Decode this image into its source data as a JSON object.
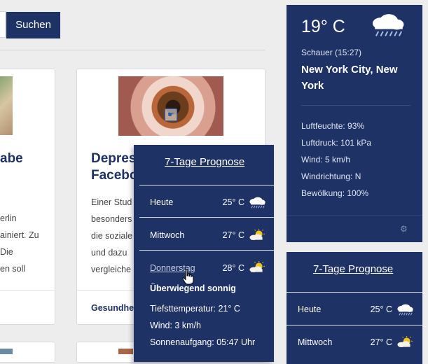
{
  "search": {
    "button_label": "Suchen"
  },
  "articles": [
    {
      "title": "abe",
      "excerpt": [
        "erlin",
        "ainiert. Zu",
        " Die",
        "en soll"
      ]
    },
    {
      "title": "Depressiv durch Facebook",
      "title_lines": [
        "Depres",
        "Facebo"
      ],
      "excerpt": [
        "Einer Stud",
        "besonders",
        "die soziale",
        "und dazu",
        "vergleiche"
      ],
      "category": "Gesundhe"
    }
  ],
  "weather": {
    "temperature": "19° C",
    "status": "Schauer (15:27)",
    "city": "New York City, New York",
    "icon": "rain-cloud-icon",
    "details": [
      "Luftfeuchte: 93%",
      "Luftdruck: 101 kPa",
      "Wind: 5 km/h",
      "Windrichtung: N",
      "Bewölkung: 100%"
    ]
  },
  "forecast_popup": {
    "title": "7-Tage Prognose",
    "rows": [
      {
        "day": "Heute",
        "temp": "25° C",
        "icon": "rain-cloud-icon"
      },
      {
        "day": "Mittwoch",
        "temp": "27° C",
        "icon": "sun-cloud-icon"
      },
      {
        "day": "Donnerstag",
        "temp": "28° C",
        "icon": "sun-cloud-icon"
      }
    ],
    "expanded": {
      "summary": "Überwiegend sonnig",
      "details": [
        "Tiefsttemperatur: 21° C",
        "Wind: 3 km/h",
        "Sonnenaufgang: 05:47 Uhr"
      ]
    }
  },
  "forecast_right": {
    "title": "7-Tage Prognose",
    "rows": [
      {
        "day": "Heute",
        "temp": "25° C",
        "icon": "rain-cloud-icon"
      },
      {
        "day": "Mittwoch",
        "temp": "27° C",
        "icon": "sun-cloud-icon"
      }
    ]
  },
  "colors": {
    "navy": "#1f3266",
    "page_background": "#ecedec"
  }
}
